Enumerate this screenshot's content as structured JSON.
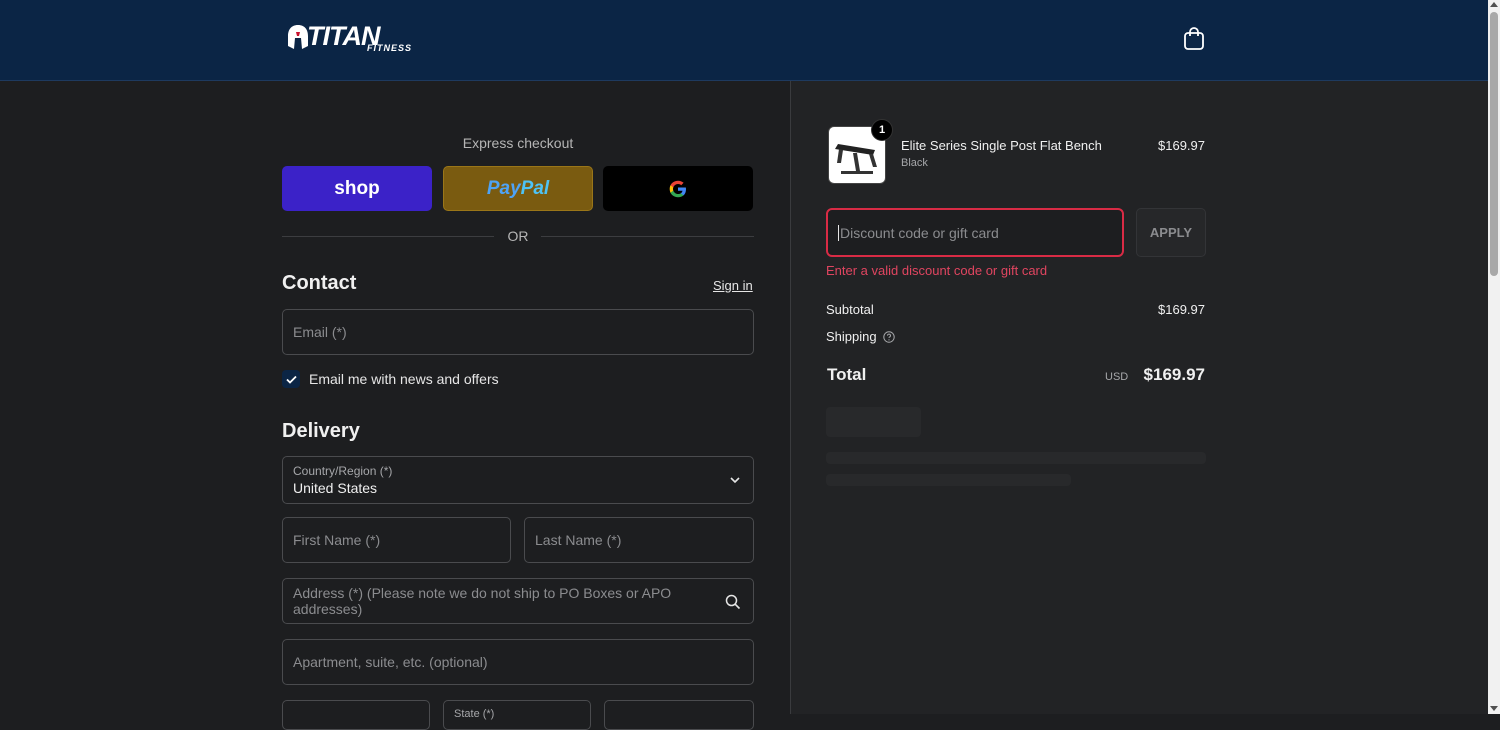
{
  "brand": {
    "logo_main": "TITAN",
    "logo_sub": "FITNESS"
  },
  "express": {
    "label": "Express checkout",
    "shop_label": "shop",
    "paypal_label_1": "Pay",
    "paypal_label_2": "Pal",
    "or_label": "OR"
  },
  "contact": {
    "title": "Contact",
    "sign_in": "Sign in",
    "email_placeholder": "Email (*)",
    "news_label": "Email me with news and offers",
    "news_checked": true
  },
  "delivery": {
    "title": "Delivery",
    "country_label": "Country/Region (*)",
    "country_value": "United States",
    "first_name_placeholder": "First Name (*)",
    "last_name_placeholder": "Last Name (*)",
    "address_placeholder": "Address (*) (Please note we do not ship to PO Boxes or APO addresses)",
    "apartment_placeholder": "Apartment, suite, etc. (optional)",
    "state_label": "State (*)"
  },
  "cart": {
    "item": {
      "name": "Elite Series Single Post Flat Bench",
      "variant": "Black",
      "price": "$169.97",
      "quantity": "1"
    },
    "discount_placeholder": "Discount code or gift card",
    "apply_label": "APPLY",
    "discount_error": "Enter a valid discount code or gift card",
    "subtotal_label": "Subtotal",
    "subtotal_value": "$169.97",
    "shipping_label": "Shipping",
    "total_label": "Total",
    "currency": "USD",
    "total_value": "$169.97"
  },
  "colors": {
    "header_bg": "#0b2545",
    "shop_purple": "#3b22c8",
    "paypal_gold": "#7a5b10",
    "error_red": "#d92b45"
  }
}
